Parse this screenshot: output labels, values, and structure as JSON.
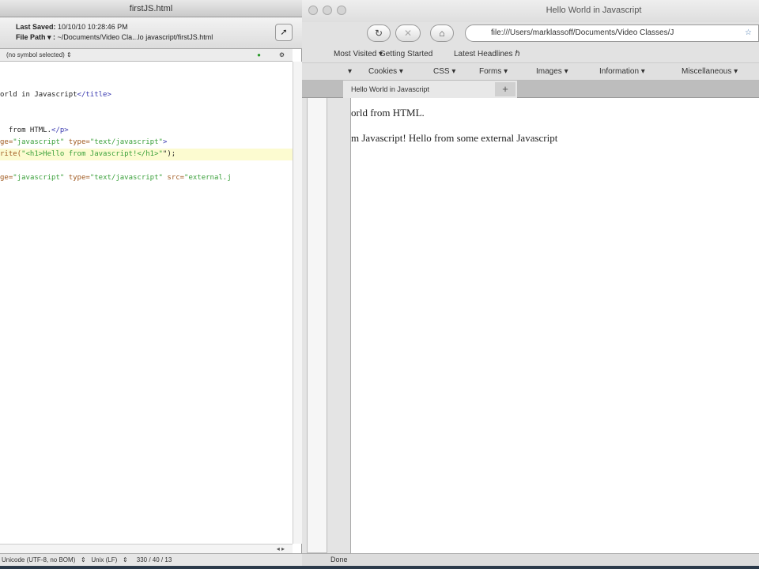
{
  "editor": {
    "title": "firstJS.html",
    "last_saved_label": "Last Saved:",
    "last_saved_value": "10/10/10 10:28:46 PM",
    "file_path_label": "File Path ▾ :",
    "file_path_value": "~/Documents/Video Cla...lo javascript/firstJS.html",
    "symbol_selector": "(no symbol selected)",
    "code_lines": [
      {
        "parts": [
          [
            "",
            "orld in Javascript"
          ],
          [
            "tag",
            "</title>"
          ]
        ]
      },
      {
        "parts": [
          [
            "",
            "  from HTML."
          ],
          [
            "tag",
            "</p>"
          ]
        ]
      },
      {
        "parts": [
          [
            "attr",
            "ge="
          ],
          [
            "str",
            "\"javascript\""
          ],
          [
            "attr",
            " type="
          ],
          [
            "str",
            "\"text/javascript\""
          ],
          [
            "tag",
            ">"
          ]
        ]
      },
      {
        "parts": [
          [
            "attr",
            "rite("
          ],
          [
            "str",
            "\"<h1>Hello from Javascript!</h1>\""
          ],
          [
            "",
            "\");"
          ]
        ]
      },
      {
        "parts": [
          [
            "attr",
            "ge="
          ],
          [
            "str",
            "\"javascript\""
          ],
          [
            "attr",
            " type="
          ],
          [
            "str",
            "\"text/javascript\""
          ],
          [
            "attr",
            " src="
          ],
          [
            "str",
            "\"external.j"
          ]
        ]
      }
    ],
    "status_encoding": "Unicode (UTF-8, no BOM)",
    "status_line_endings": "Unix (LF)",
    "status_counts": "330 / 40 / 13"
  },
  "browser": {
    "title": "Hello World in Javascript",
    "url": "file:///Users/marklassoff/Documents/Video Classes/J",
    "bookmarks": [
      "Most Visited ▾",
      "Getting Started",
      "Latest Headlines ℏ"
    ],
    "devbar": [
      "▾",
      "Cookies ▾",
      "CSS ▾",
      "Forms ▾",
      "Images ▾",
      "Information ▾",
      "Miscellaneous ▾"
    ],
    "tab_label": "Hello World in Javascript",
    "new_tab": "+",
    "content_lines": [
      "orld from HTML.",
      "m Javascript! Hello from some external Javascript"
    ],
    "status": "Done"
  }
}
